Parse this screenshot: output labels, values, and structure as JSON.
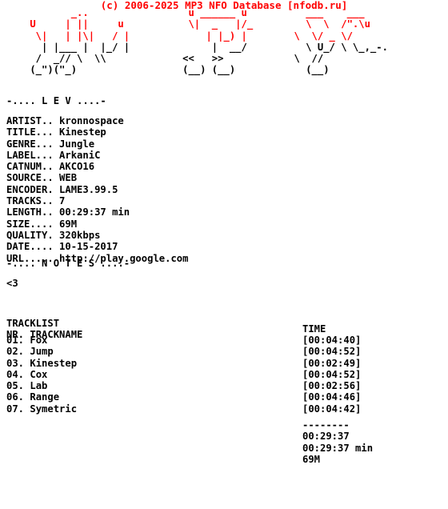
{
  "header": {
    "copyright": "(c) 2006-2025 MP3 NFO Database [nfodb.ru]",
    "color": "#ff0000"
  },
  "ascii_art": {
    "lines": [
      "           _..                 u ______ u          ___    ___",
      "    U     | ||     u           \\|  _   |/_         \\  \\  /\"./u",
      "     \\|   | |\\|   / |             | |_) |        \\  \\/ _ \\/",
      "      | |___ |  |_/ |              |  __/          \\ U_/ \\ \\_,_-.",
      "     /  _// \\  \\\\             <<   >>            \\  //",
      "    (_\")(\"_)                  (__) (__)            (__)"
    ],
    "letters": [
      "L",
      "E",
      "V"
    ]
  },
  "section_release": {
    "title": "-.... L E V ....-",
    "fields": [
      {
        "label": "ARTIST..",
        "value": "kronnospace"
      },
      {
        "label": "TITLE...",
        "value": "Kinestep"
      },
      {
        "label": "GENRE...",
        "value": "Jungle"
      },
      {
        "label": "LABEL...",
        "value": "ArkaniC"
      },
      {
        "label": "CATNUM..",
        "value": "AKCO16"
      },
      {
        "label": "SOURCE..",
        "value": "WEB"
      },
      {
        "label": "ENCODER.",
        "value": "LAME3.99.5"
      },
      {
        "label": "TRACKS..",
        "value": "7"
      },
      {
        "label": "LENGTH..",
        "value": "00:29:37 min"
      },
      {
        "label": "SIZE....",
        "value": "69M"
      },
      {
        "label": "QUALITY.",
        "value": "320kbps"
      },
      {
        "label": "DATE....",
        "value": "10-15-2017"
      },
      {
        "label": "URL.....",
        "value": "http://play.google.com"
      }
    ]
  },
  "section_notes": {
    "title": "-.... N O T E S ....-",
    "body": "<3"
  },
  "section_tracklist": {
    "title": "TRACKLIST",
    "columns": {
      "nr": "NR.",
      "trackname": "TRACKNAME",
      "time": "TIME"
    },
    "tracks": [
      {
        "nr": "01.",
        "name": "Fox",
        "time": "[00:04:40]"
      },
      {
        "nr": "02.",
        "name": "Jump",
        "time": "[00:04:52]"
      },
      {
        "nr": "03.",
        "name": "Kinestep",
        "time": "[00:02:49]"
      },
      {
        "nr": "04.",
        "name": "Cox",
        "time": "[00:04:52]"
      },
      {
        "nr": "05.",
        "name": "Lab",
        "time": "[00:02:56]"
      },
      {
        "nr": "06.",
        "name": "Range",
        "time": "[00:04:46]"
      },
      {
        "nr": "07.",
        "name": "Symetric",
        "time": "[00:04:42]"
      }
    ],
    "totals": {
      "divider": "--------",
      "total_time": "00:29:37",
      "total_length": "00:29:37 min",
      "total_size": "69M"
    }
  }
}
